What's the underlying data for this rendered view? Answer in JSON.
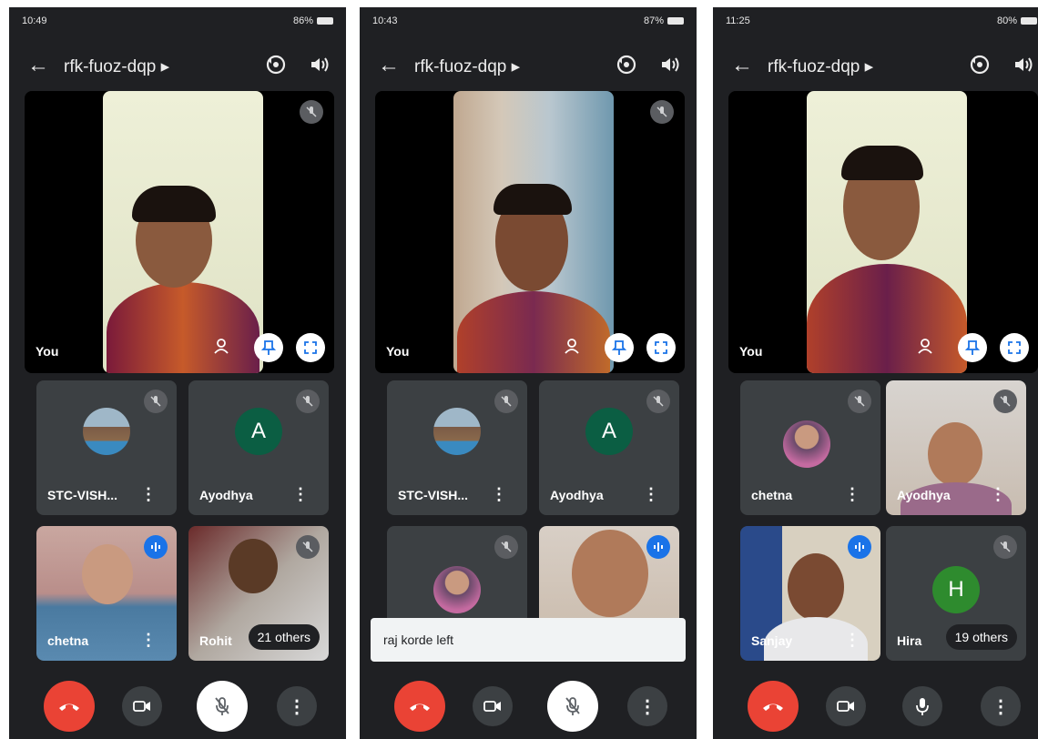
{
  "meeting_code": "rfk-fuoz-dqp",
  "you_label": "You",
  "screens": [
    {
      "status": {
        "time": "10:49",
        "battery": "86%"
      },
      "tiles": {
        "t1": {
          "name": "STC-VISH..."
        },
        "t2": {
          "name": "Ayodhya",
          "initial": "A"
        },
        "t3": {
          "name": "chetna"
        },
        "t4": {
          "name": "Rohit",
          "others": "21 others"
        }
      }
    },
    {
      "status": {
        "time": "10:43",
        "battery": "87%"
      },
      "tiles": {
        "t1": {
          "name": "STC-VISH..."
        },
        "t2": {
          "name": "Ayodhya",
          "initial": "A"
        }
      },
      "toast": "raj korde left"
    },
    {
      "status": {
        "time": "11:25",
        "battery": "80%"
      },
      "tiles": {
        "t1": {
          "name": "chetna"
        },
        "t2": {
          "name": "Ayodhya"
        },
        "t3": {
          "name": "Sanjay"
        },
        "t4": {
          "name": "Hira",
          "initial": "H",
          "others": "19 others"
        }
      }
    }
  ],
  "colors": {
    "end_call": "#ea4335",
    "avatar_a": "#0b5e43",
    "avatar_h": "#2e8b2e",
    "speaking": "#1a73e8"
  }
}
